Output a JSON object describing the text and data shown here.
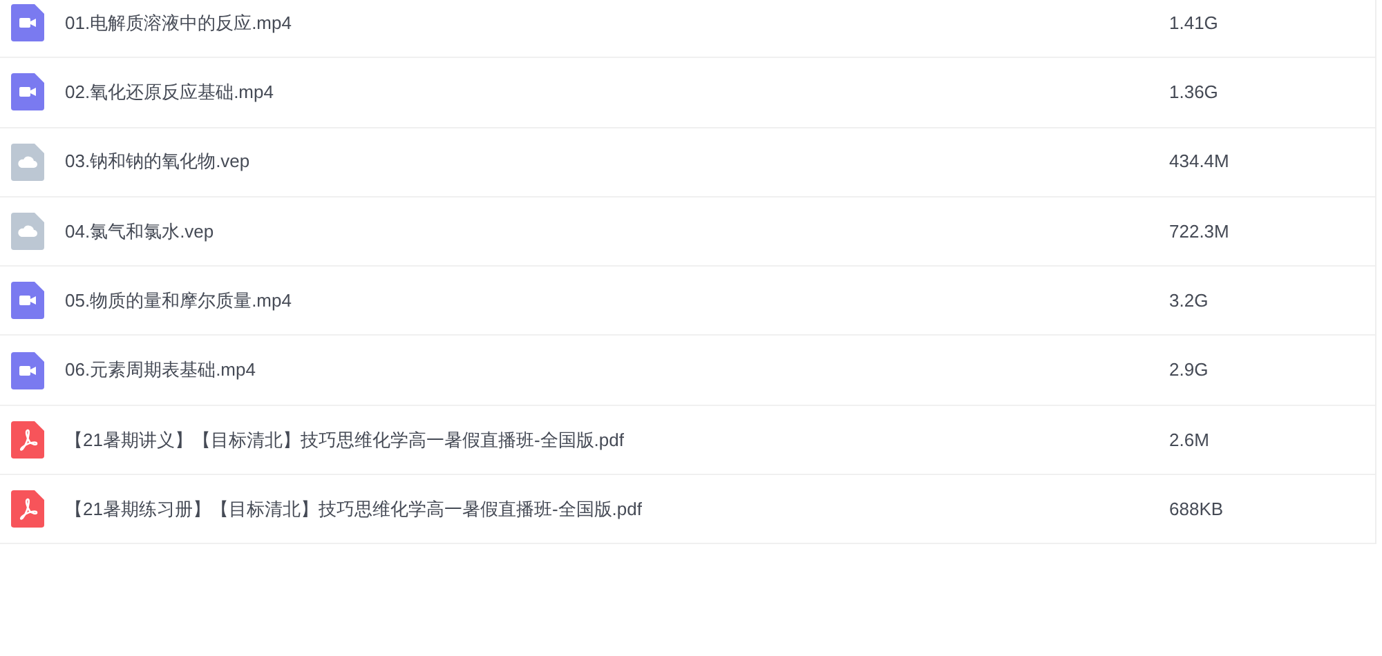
{
  "files": [
    {
      "kind": "video",
      "name": "01.电解质溶液中的反应.mp4",
      "size": "1.41G"
    },
    {
      "kind": "video",
      "name": "02.氧化还原反应基础.mp4",
      "size": "1.36G"
    },
    {
      "kind": "cloud",
      "name": "03.钠和钠的氧化物.vep",
      "size": "434.4M"
    },
    {
      "kind": "cloud",
      "name": "04.氯气和氯水.vep",
      "size": "722.3M"
    },
    {
      "kind": "video",
      "name": "05.物质的量和摩尔质量.mp4",
      "size": "3.2G"
    },
    {
      "kind": "video",
      "name": "06.元素周期表基础.mp4",
      "size": "2.9G"
    },
    {
      "kind": "pdf",
      "name": "【21暑期讲义】【目标清北】技巧思维化学高一暑假直播班-全国版.pdf",
      "size": "2.6M"
    },
    {
      "kind": "pdf",
      "name": "【21暑期练习册】【目标清北】技巧思维化学高一暑假直播班-全国版.pdf",
      "size": "688KB"
    }
  ]
}
